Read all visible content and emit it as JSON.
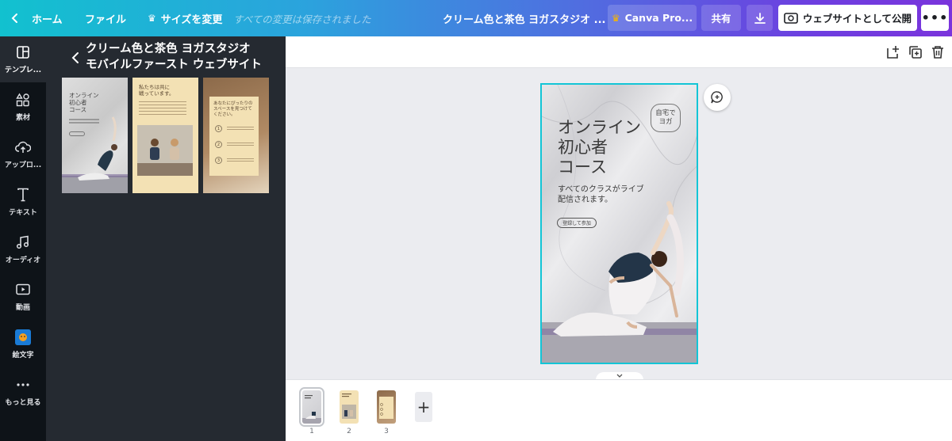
{
  "topbar": {
    "home_label": "ホーム",
    "file_label": "ファイル",
    "resize_label": "サイズを変更",
    "saved_status": "すべての変更は保存されました",
    "doc_title": "クリーム色と茶色 ヨガスタジオ ...",
    "pro_label": "Canva Pro...",
    "share_label": "共有",
    "publish_label": "ウェブサイトとして公開",
    "gradient_colors": [
      "#12c1cf",
      "#7a34dc"
    ]
  },
  "rail": {
    "items": [
      {
        "label": "テンプレ...",
        "icon": "template-icon"
      },
      {
        "label": "素材",
        "icon": "elements-icon"
      },
      {
        "label": "アップロ...",
        "icon": "upload-icon"
      },
      {
        "label": "テキスト",
        "icon": "text-icon"
      },
      {
        "label": "オーディオ",
        "icon": "audio-icon"
      },
      {
        "label": "動画",
        "icon": "video-icon"
      },
      {
        "label": "絵文字",
        "icon": "emoji-icon"
      },
      {
        "label": "もっと見る",
        "icon": "more-dots-icon"
      }
    ]
  },
  "panel": {
    "title_line1": "クリーム色と茶色 ヨガスタジオ",
    "title_line2": "モバイルファースト ウェブサイト",
    "thumbs": [
      {
        "heading": "オンライン\n初心者\nコース"
      },
      {
        "heading": "私たちは共に\n戦っています。"
      },
      {
        "heading": "あなたにぴったりの\nスペースを見つけて\nください。",
        "steps": [
          "1",
          "2",
          "3"
        ]
      }
    ]
  },
  "page": {
    "heading": "オンライン\n初心者\nコース",
    "subtitle": "すべてのクラスがライブ\n配信されます。",
    "button": "登録して参加",
    "badge": "自宅で\nヨガ"
  },
  "pages_strip": {
    "pages": [
      "1",
      "2",
      "3"
    ],
    "selected": "1"
  }
}
